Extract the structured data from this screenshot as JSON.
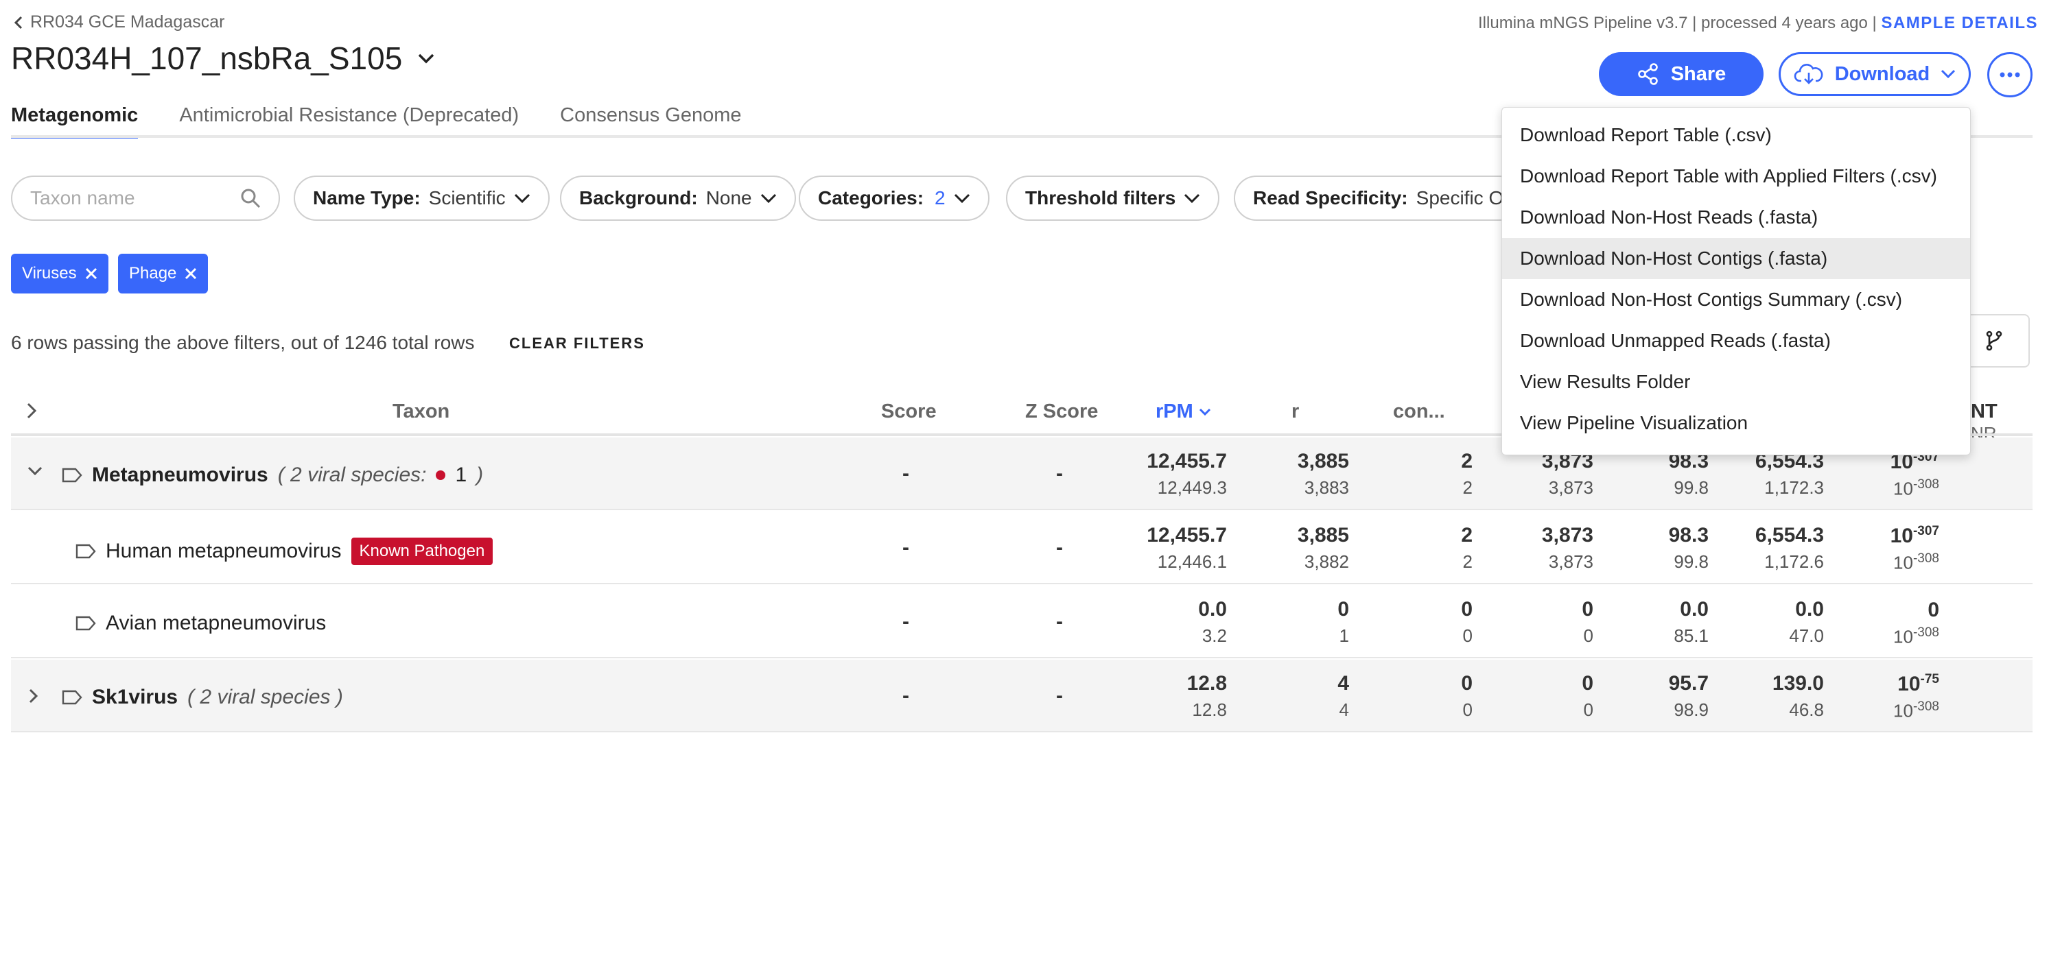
{
  "header": {
    "back_label": "RR034 GCE Madagascar",
    "sample_name": "RR034H_107_nsbRa_S105",
    "pipeline_text": "Illumina mNGS Pipeline v3.7 | processed 4 years ago |",
    "sample_details_label": "SAMPLE DETAILS",
    "share_label": "Share",
    "download_label": "Download"
  },
  "tabs": [
    {
      "label": "Metagenomic",
      "active": true
    },
    {
      "label": "Antimicrobial Resistance (Deprecated)",
      "active": false
    },
    {
      "label": "Consensus Genome",
      "active": false
    }
  ],
  "filters": {
    "search_placeholder": "Taxon name",
    "name_type_label": "Name Type:",
    "name_type_value": "Scientific",
    "background_label": "Background:",
    "background_value": "None",
    "categories_label": "Categories:",
    "categories_value": "2",
    "threshold_label": "Threshold filters",
    "read_spec_label": "Read Specificity:",
    "read_spec_value": "Specific On",
    "tags": [
      "Viruses",
      "Phage"
    ],
    "row_count_text": "6 rows passing the above filters, out of 1246 total rows",
    "clear_label": "CLEAR FILTERS"
  },
  "table": {
    "headers": {
      "taxon": "Taxon",
      "score": "Score",
      "zscore": "Z Score",
      "rpm": "rPM",
      "r": "r",
      "contig": "con...",
      "ea_top": "NT",
      "ea_bottom": "NR"
    },
    "rows": [
      {
        "name": "Metapneumovirus",
        "note_pre": "( 2 viral species:",
        "note_count": "1",
        "note_post": ")",
        "score": "-",
        "zscore": "-",
        "rpm": [
          "12,455.7",
          "12,449.3"
        ],
        "r": [
          "3,885",
          "3,883"
        ],
        "contig": [
          "2",
          "2"
        ],
        "contig_r": [
          "3,873",
          "3,873"
        ],
        "pid": [
          "98.3",
          "99.8"
        ],
        "alen": [
          "6,554.3",
          "1,172.3"
        ],
        "ea_nt_base": "10",
        "ea_nt_exp": "-307",
        "ea_nr_base": "10",
        "ea_nr_exp": "-308"
      },
      {
        "name": "Human metapneumovirus",
        "badge": "Known Pathogen",
        "score": "-",
        "zscore": "-",
        "rpm": [
          "12,455.7",
          "12,446.1"
        ],
        "r": [
          "3,885",
          "3,882"
        ],
        "contig": [
          "2",
          "2"
        ],
        "contig_r": [
          "3,873",
          "3,873"
        ],
        "pid": [
          "98.3",
          "99.8"
        ],
        "alen": [
          "6,554.3",
          "1,172.6"
        ],
        "ea_nt_base": "10",
        "ea_nt_exp": "-307",
        "ea_nr_base": "10",
        "ea_nr_exp": "-308"
      },
      {
        "name": "Avian metapneumovirus",
        "score": "-",
        "zscore": "-",
        "rpm": [
          "0.0",
          "3.2"
        ],
        "r": [
          "0",
          "1"
        ],
        "contig": [
          "0",
          "0"
        ],
        "contig_r": [
          "0",
          "0"
        ],
        "pid": [
          "0.0",
          "85.1"
        ],
        "alen": [
          "0.0",
          "47.0"
        ],
        "ea_nt_base": "0",
        "ea_nt_exp": "",
        "ea_nr_base": "10",
        "ea_nr_exp": "-308"
      },
      {
        "name": "Sk1virus",
        "note_pre": "( 2 viral species )",
        "score": "-",
        "zscore": "-",
        "rpm": [
          "12.8",
          "12.8"
        ],
        "r": [
          "4",
          "4"
        ],
        "contig": [
          "0",
          "0"
        ],
        "contig_r": [
          "0",
          "0"
        ],
        "pid": [
          "95.7",
          "98.9"
        ],
        "alen": [
          "139.0",
          "46.8"
        ],
        "ea_nt_base": "10",
        "ea_nt_exp": "-75",
        "ea_nr_base": "10",
        "ea_nr_exp": "-308"
      }
    ]
  },
  "download_menu": [
    "Download Report Table (.csv)",
    "Download Report Table with Applied Filters (.csv)",
    "Download Non-Host Reads (.fasta)",
    "Download Non-Host Contigs (.fasta)",
    "Download Non-Host Contigs Summary (.csv)",
    "Download Unmapped Reads (.fasta)",
    "View Results Folder",
    "View Pipeline Visualization"
  ],
  "colors": {
    "accent": "#3867fa",
    "pathogen": "#c8102e",
    "genus_row_bg": "#f4f4f4",
    "menu_hover": "#eaeaea"
  }
}
